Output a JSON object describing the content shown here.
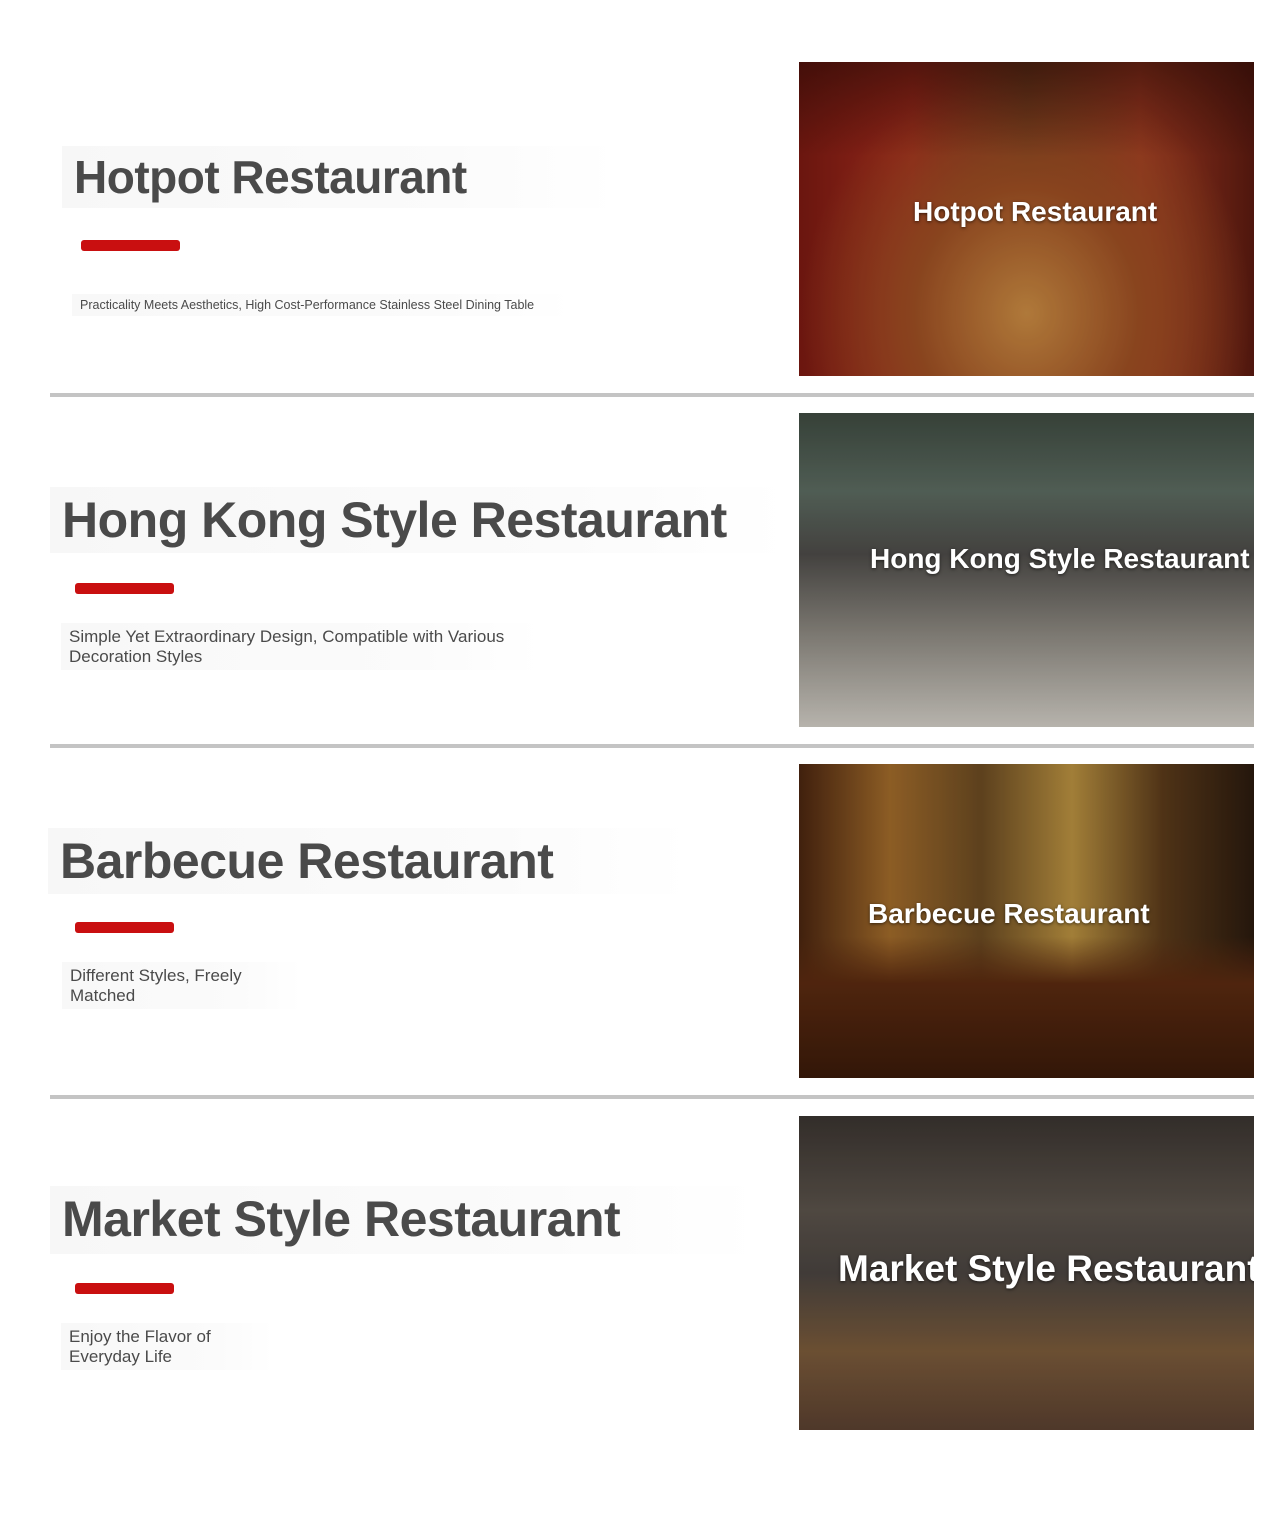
{
  "sections": [
    {
      "title": "Hotpot Restaurant",
      "description": "Practicality Meets Aesthetics, High Cost-Performance Stainless Steel Dining Table",
      "photo_label": "Hotpot Restaurant"
    },
    {
      "title": "Hong Kong Style Restaurant",
      "description": "Simple Yet Extraordinary Design, Compatible with Various Decoration Styles",
      "photo_label": "Hong Kong Style Restaurant"
    },
    {
      "title": "Barbecue Restaurant",
      "description": "Different Styles, Freely Matched",
      "photo_label": "Barbecue Restaurant"
    },
    {
      "title": "Market Style Restaurant",
      "description": "Enjoy the Flavor of Everyday Life",
      "photo_label": "Market Style Restaurant"
    }
  ],
  "colors": {
    "accent": "#c90f10",
    "title_text": "#4a4a4a",
    "divider": "#c4c4c4"
  }
}
